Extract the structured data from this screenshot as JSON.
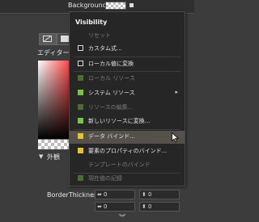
{
  "property": {
    "label": "Background"
  },
  "editor": {
    "label": "エディター"
  },
  "section": {
    "label": "外観",
    "arrow": "▼"
  },
  "border_thickness": {
    "label": "BorderThickness",
    "fields": [
      {
        "arrow": "⬌",
        "value": "0"
      },
      {
        "arrow": "⬍",
        "value": "0"
      },
      {
        "arrow": "⬌",
        "value": "0"
      },
      {
        "arrow": "⬍",
        "value": "0"
      }
    ]
  },
  "menu": {
    "title": "Visibility",
    "items": [
      {
        "label": "リセット",
        "state": "disabled",
        "box": "none"
      },
      {
        "label": "カスタム式...",
        "state": "enabled",
        "box": "empty"
      },
      {
        "label": "ローカル値に変換",
        "state": "enabled",
        "box": "empty"
      },
      {
        "label": "ローカル リソース",
        "state": "disabled",
        "box": "green-dim"
      },
      {
        "label": "システム リソース",
        "state": "enabled",
        "box": "green",
        "submenu": "▸"
      },
      {
        "label": "リソースの編集...",
        "state": "disabled",
        "box": "green-dim"
      },
      {
        "label": "新しいリソースに変換...",
        "state": "enabled",
        "box": "green"
      },
      {
        "label": "データ バインド...",
        "state": "highlighted",
        "box": "yellow"
      },
      {
        "label": "要素のプロパティのバインド...",
        "state": "enabled",
        "box": "yellow"
      },
      {
        "label": "テンプレートのバインド",
        "state": "disabled",
        "box": "none"
      },
      {
        "label": "現在値の記録",
        "state": "disabled",
        "box": "green-dim"
      }
    ]
  },
  "colors": {
    "menu_bg": "#262626",
    "highlight": "#56504a",
    "green": "#7bc14b",
    "yellow": "#e2c23a"
  }
}
